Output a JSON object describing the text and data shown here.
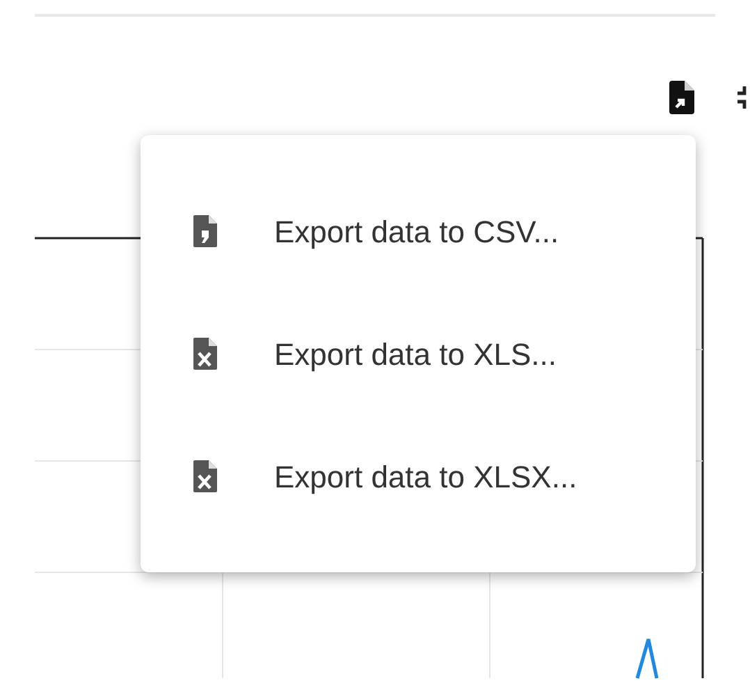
{
  "export_menu": {
    "items": [
      {
        "kind": "csv",
        "label": "Export data to CSV..."
      },
      {
        "kind": "xls",
        "label": "Export data to XLS..."
      },
      {
        "kind": "xls",
        "label": "Export data to XLSX..."
      }
    ]
  }
}
